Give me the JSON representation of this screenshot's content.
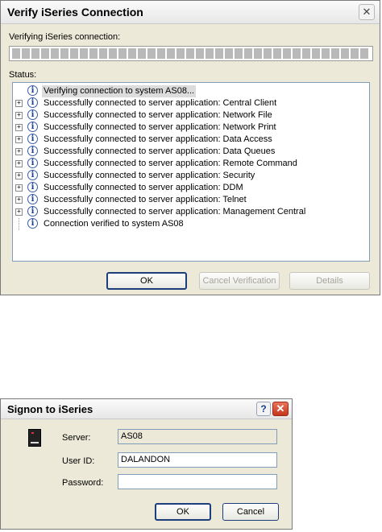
{
  "verify_dialog": {
    "title": "Verify iSeries Connection",
    "close_glyph": "✕",
    "progress_label": "Verifying iSeries connection:",
    "status_label": "Status:",
    "tree_items": [
      {
        "text": "Verifying connection to system AS08...",
        "expander": false,
        "selected": true,
        "icon": "info-icon"
      },
      {
        "text": "Successfully connected to server application: Central Client",
        "expander": true,
        "icon": "info-icon"
      },
      {
        "text": "Successfully connected to server application: Network File",
        "expander": true,
        "icon": "info-icon"
      },
      {
        "text": "Successfully connected to server application: Network Print",
        "expander": true,
        "icon": "info-icon"
      },
      {
        "text": "Successfully connected to server application: Data Access",
        "expander": true,
        "icon": "info-icon"
      },
      {
        "text": "Successfully connected to server application: Data Queues",
        "expander": true,
        "icon": "info-icon"
      },
      {
        "text": "Successfully connected to server application: Remote Command",
        "expander": true,
        "icon": "info-icon"
      },
      {
        "text": "Successfully connected to server application: Security",
        "expander": true,
        "icon": "info-icon"
      },
      {
        "text": "Successfully connected to server application: DDM",
        "expander": true,
        "icon": "info-icon"
      },
      {
        "text": "Successfully connected to server application: Telnet",
        "expander": true,
        "icon": "info-icon"
      },
      {
        "text": "Successfully connected to server application: Management Central",
        "expander": true,
        "icon": "info-icon"
      },
      {
        "text": "Connection verified to system AS08",
        "expander": false,
        "icon": "info-icon"
      }
    ],
    "buttons": {
      "ok": "OK",
      "cancel_verification": "Cancel Verification",
      "details": "Details"
    }
  },
  "signon_dialog": {
    "title": "Signon to iSeries",
    "help_glyph": "?",
    "close_glyph": "✕",
    "server_label": "Server:",
    "server_value": "AS08",
    "userid_label": "User ID:",
    "userid_value": "DALANDON",
    "password_label": "Password:",
    "password_value": "",
    "buttons": {
      "ok": "OK",
      "cancel": "Cancel"
    }
  },
  "colors": {
    "dialog_bg": "#ece9d8",
    "button_border": "#1c3f7c",
    "close_red": "#c4371c"
  }
}
